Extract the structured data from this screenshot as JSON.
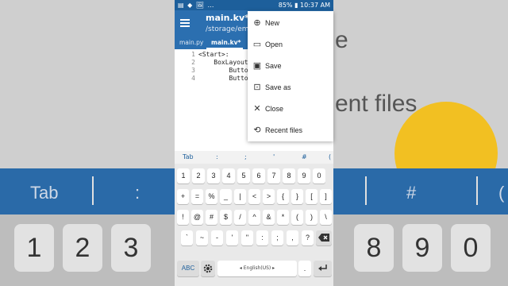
{
  "status": {
    "left_icons": "▤ ◆ 🖼 …",
    "right_text": "85% ▮ 10:37 AM"
  },
  "app": {
    "title": "main.kv*",
    "subtitle": "/storage/em",
    "tabs": [
      "main.py",
      "main.kv*"
    ]
  },
  "editor": {
    "line_numbers": [
      "1",
      "2",
      "3",
      "4"
    ],
    "lines": [
      "<Start>:",
      "    BoxLayout:",
      "        Button:",
      "        Button:"
    ]
  },
  "menu": {
    "items": [
      {
        "label": "New",
        "icon": "add-circle-icon",
        "glyph": "⊕"
      },
      {
        "label": "Open",
        "icon": "folder-icon",
        "glyph": "▭"
      },
      {
        "label": "Save",
        "icon": "save-icon",
        "glyph": "▣"
      },
      {
        "label": "Save as",
        "icon": "save-as-icon",
        "glyph": "⊡"
      },
      {
        "label": "Close",
        "icon": "close-icon",
        "glyph": "✕"
      },
      {
        "label": "Recent files",
        "icon": "history-icon",
        "glyph": "⟲"
      }
    ]
  },
  "suggestions": [
    "Tab",
    ":",
    ";",
    "'",
    "#",
    "("
  ],
  "keyboard": {
    "row1": [
      "1",
      "2",
      "3",
      "4",
      "5",
      "6",
      "7",
      "8",
      "9",
      "0"
    ],
    "row2": [
      "+",
      "=",
      "%",
      "_",
      "|",
      "<",
      ">",
      "{",
      "}",
      "[",
      "]"
    ],
    "row3": [
      "!",
      "@",
      "#",
      "$",
      "/",
      "^",
      "&",
      "*",
      "(",
      ")",
      "\\"
    ],
    "row4": [
      "`",
      "~",
      "-",
      "'",
      "\"",
      ":",
      ";",
      ",",
      "?"
    ],
    "abc": "ABC",
    "space": "English(US)",
    "period": ".",
    "backspace_icon": "backspace-icon",
    "settings_icon": "gear-icon",
    "enter_icon": "enter-icon"
  },
  "background": {
    "words": [
      "e",
      "ent files"
    ],
    "strip": [
      "Tab",
      ":",
      "#",
      "("
    ],
    "keys": [
      "1",
      "2",
      "3",
      "8",
      "9",
      "0"
    ]
  },
  "colors": {
    "appbar": "#2b6fb0",
    "status": "#1d5f9b",
    "fab": "#f2c022"
  }
}
